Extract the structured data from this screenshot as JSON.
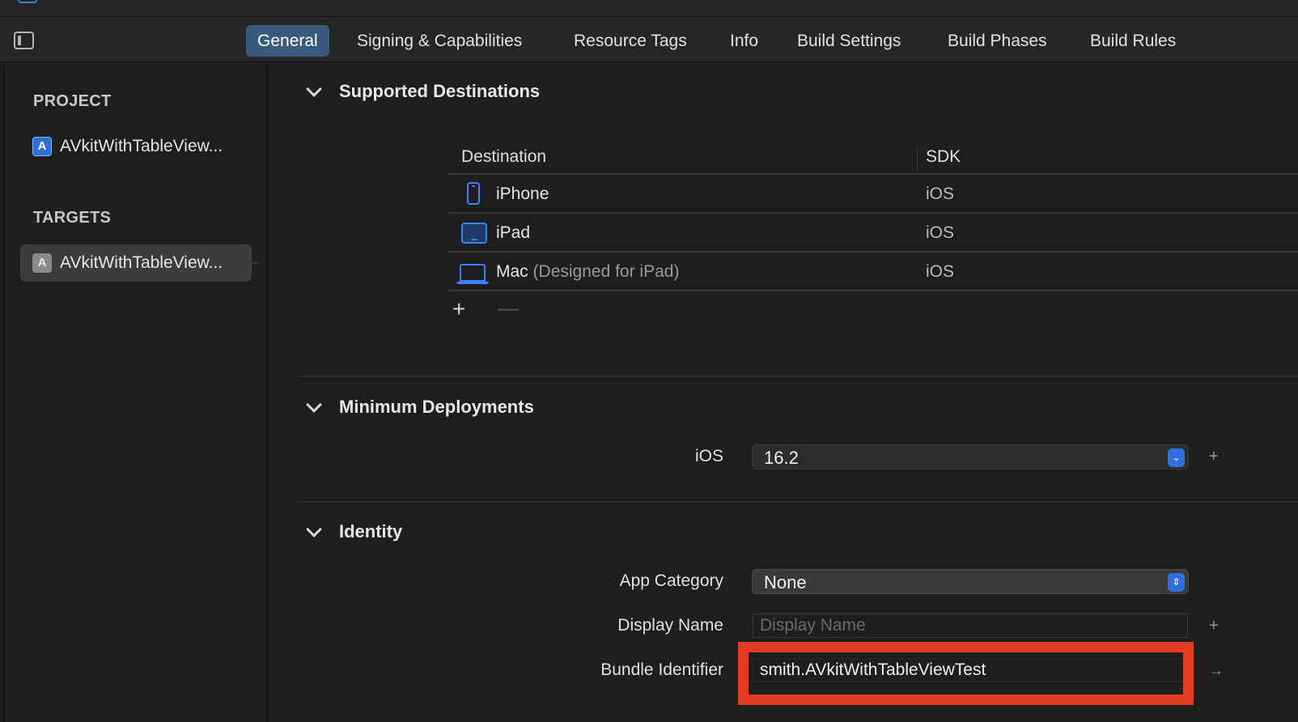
{
  "tabs": [
    "General",
    "Signing & Capabilities",
    "Resource Tags",
    "Info",
    "Build Settings",
    "Build Phases",
    "Build Rules"
  ],
  "active_tab": "General",
  "sidebar": {
    "project_header": "PROJECT",
    "project_item": "AVkitWithTableView...",
    "targets_header": "TARGETS",
    "target_item": "AVkitWithTableView..."
  },
  "supported_destinations": {
    "title": "Supported Destinations",
    "col_destination": "Destination",
    "col_sdk": "SDK",
    "rows": [
      {
        "name": "iPhone",
        "suffix": "",
        "sdk": "iOS",
        "icon": "iphone-icon"
      },
      {
        "name": "iPad",
        "suffix": "",
        "sdk": "iOS",
        "icon": "ipad-icon"
      },
      {
        "name": "Mac",
        "suffix": "(Designed for iPad)",
        "sdk": "iOS",
        "icon": "mac-icon"
      }
    ],
    "add_symbol": "+",
    "remove_symbol": "—"
  },
  "minimum_deployments": {
    "title": "Minimum Deployments",
    "label": "iOS",
    "value": "16.2"
  },
  "identity": {
    "title": "Identity",
    "app_category_label": "App Category",
    "app_category_value": "None",
    "display_name_label": "Display Name",
    "display_name_placeholder": "Display Name",
    "display_name_value": "",
    "bundle_identifier_label": "Bundle Identifier",
    "bundle_identifier_value": "smith.AVkitWithTableViewTest"
  },
  "symbols": {
    "plus": "+",
    "arrow": "→"
  },
  "colors": {
    "accent": "#2f6fe0",
    "highlight": "#e23b24",
    "active_tab": "#3a5a7c"
  }
}
